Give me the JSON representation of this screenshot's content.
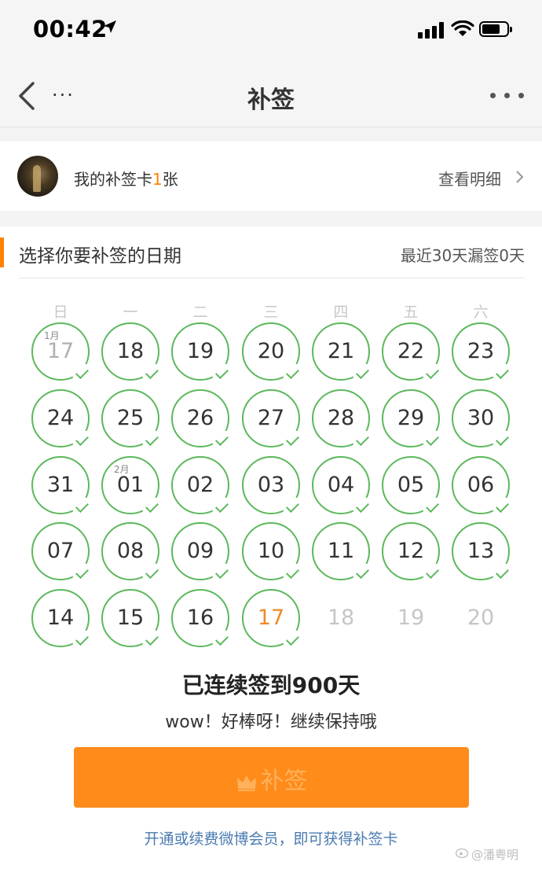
{
  "status_bar": {
    "time": "00:42"
  },
  "nav": {
    "left_dots": "...",
    "title": "补签"
  },
  "user_card": {
    "text_prefix": "我的补签卡",
    "card_count": "1",
    "text_suffix": "张",
    "detail_link": "查看明细"
  },
  "section": {
    "title": "选择你要补签的日期",
    "missed_summary": "最近30天漏签0天"
  },
  "weekdays": [
    "日",
    "一",
    "二",
    "三",
    "四",
    "五",
    "六"
  ],
  "calendar": {
    "rows": [
      [
        {
          "day": "17",
          "month_label": "1月",
          "state": "checked-muted"
        },
        {
          "day": "18",
          "state": "checked"
        },
        {
          "day": "19",
          "state": "checked"
        },
        {
          "day": "20",
          "state": "checked"
        },
        {
          "day": "21",
          "state": "checked"
        },
        {
          "day": "22",
          "state": "checked"
        },
        {
          "day": "23",
          "state": "checked"
        }
      ],
      [
        {
          "day": "24",
          "state": "checked"
        },
        {
          "day": "25",
          "state": "checked"
        },
        {
          "day": "26",
          "state": "checked"
        },
        {
          "day": "27",
          "state": "checked"
        },
        {
          "day": "28",
          "state": "checked"
        },
        {
          "day": "29",
          "state": "checked"
        },
        {
          "day": "30",
          "state": "checked"
        }
      ],
      [
        {
          "day": "31",
          "state": "checked"
        },
        {
          "day": "01",
          "month_label": "2月",
          "state": "checked"
        },
        {
          "day": "02",
          "state": "checked"
        },
        {
          "day": "03",
          "state": "checked"
        },
        {
          "day": "04",
          "state": "checked"
        },
        {
          "day": "05",
          "state": "checked"
        },
        {
          "day": "06",
          "state": "checked"
        }
      ],
      [
        {
          "day": "07",
          "state": "checked"
        },
        {
          "day": "08",
          "state": "checked"
        },
        {
          "day": "09",
          "state": "checked"
        },
        {
          "day": "10",
          "state": "checked"
        },
        {
          "day": "11",
          "state": "checked"
        },
        {
          "day": "12",
          "state": "checked"
        },
        {
          "day": "13",
          "state": "checked"
        }
      ],
      [
        {
          "day": "14",
          "state": "checked"
        },
        {
          "day": "15",
          "state": "checked"
        },
        {
          "day": "16",
          "state": "checked"
        },
        {
          "day": "17",
          "state": "today"
        },
        {
          "day": "18",
          "state": "future"
        },
        {
          "day": "19",
          "state": "future"
        },
        {
          "day": "20",
          "state": "future"
        }
      ]
    ]
  },
  "streak_text": "已连续签到900天",
  "encourage_text": "wow！好棒呀！继续保持哦",
  "button": {
    "label": "补签"
  },
  "promo_text": "开通或续费微博会员，即可获得补签卡",
  "watermark": "@潘粤明",
  "colors": {
    "accent_orange": "#ff8200",
    "button_orange": "#ff8b1a",
    "check_green": "#5cb85c",
    "link_blue": "#4a7bb0"
  },
  "icons": [
    "location-arrow-icon",
    "signal-icon",
    "wifi-icon",
    "battery-icon",
    "back-chevron-icon",
    "more-dots-icon",
    "chevron-right-icon",
    "checkmark-icon",
    "crown-icon",
    "weibo-logo-icon"
  ]
}
